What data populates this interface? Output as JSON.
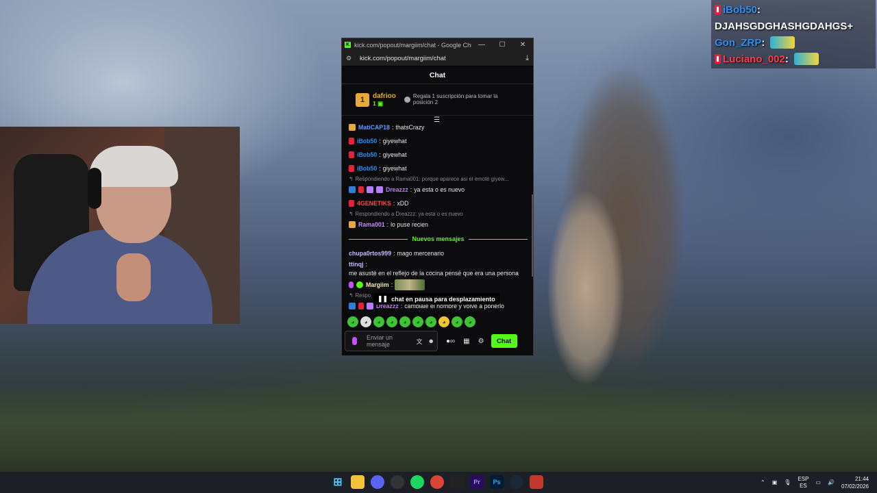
{
  "overlay_chat": [
    {
      "user": "iBob50",
      "message": "DJAHSGDGHASHGDAHGS+"
    },
    {
      "user": "Gon_ZRP",
      "message": ""
    },
    {
      "user": "Luciano_002",
      "message": ""
    }
  ],
  "window": {
    "title": "kick.com/popout/margiim/chat - Google Chro...",
    "url": "kick.com/popout/margiim/chat",
    "header": "Chat"
  },
  "pinned": {
    "rank": "1",
    "user": "dafrioo",
    "count": "1",
    "text": "Regala 1 suscripción para tomar la posición 2"
  },
  "messages": [
    {
      "type": "msg",
      "user": "MatiCAP18",
      "user_color": "#5b9bff",
      "badges": [
        "crown"
      ],
      "text": "thatsCrazy"
    },
    {
      "type": "msg",
      "user": "iBob50",
      "user_color": "#2f8ef0",
      "badges": [
        "red"
      ],
      "text": "giyewhat"
    },
    {
      "type": "msg",
      "user": "iBob50",
      "user_color": "#2f8ef0",
      "badges": [
        "red"
      ],
      "text": "giyewhat"
    },
    {
      "type": "msg",
      "user": "iBob50",
      "user_color": "#2f8ef0",
      "badges": [
        "red"
      ],
      "text": "giyewhat"
    },
    {
      "type": "reply",
      "text": "Respondiendo a Rama001: porque aparece asi el emote giyew..."
    },
    {
      "type": "msg",
      "user": "Dreazzz",
      "user_color": "#b87cff",
      "badges": [
        "blue",
        "red",
        "purple",
        "purple"
      ],
      "text": "ya esta o es nuevo"
    },
    {
      "type": "msg",
      "user": "4GENETIKS",
      "user_color": "#ff4a4a",
      "badges": [
        "red"
      ],
      "text": "xDD"
    },
    {
      "type": "reply",
      "text": "Respondiendo a Dreazzz: ya esta o es nuevo"
    },
    {
      "type": "msg",
      "user": "Rama001",
      "user_color": "#c58bff",
      "badges": [
        "crown"
      ],
      "text": "lo puse recien"
    },
    {
      "type": "divider",
      "text": "Nuevos mensajes"
    },
    {
      "type": "msg",
      "user": "chupa0rtos999",
      "user_color": "#c9b6ff",
      "badges": [],
      "text": "mago mercenario"
    },
    {
      "type": "msg",
      "user": "ttinqj",
      "user_color": "#c9b6ff",
      "badges": [],
      "text": "me asusté en el reflejo de la cocina pensé que era una persona"
    },
    {
      "type": "msg",
      "user": "Margiim",
      "user_color": "#f4e9b0",
      "badges": [
        "mic",
        "green"
      ],
      "text": "",
      "emote": true
    },
    {
      "type": "reply",
      "text": "Respo"
    },
    {
      "type": "msg",
      "user": "Dreazzz",
      "user_color": "#b87cff",
      "badges": [
        "blue",
        "red",
        "purple"
      ],
      "text": "cambiale el nombre y volve a ponerlo"
    }
  ],
  "paused_text": "chat en pausa para desplazamiento",
  "input": {
    "placeholder": "Enviar un mensaje",
    "send_label": "Chat"
  },
  "taskbar": {
    "lang_top": "ESP",
    "lang_bottom": "ES",
    "time": "21:44",
    "date": "07/02/2026"
  },
  "colors": {
    "kick_green": "#53fc18",
    "gold": "#e7a93a",
    "badge_red": "#e5223a"
  }
}
